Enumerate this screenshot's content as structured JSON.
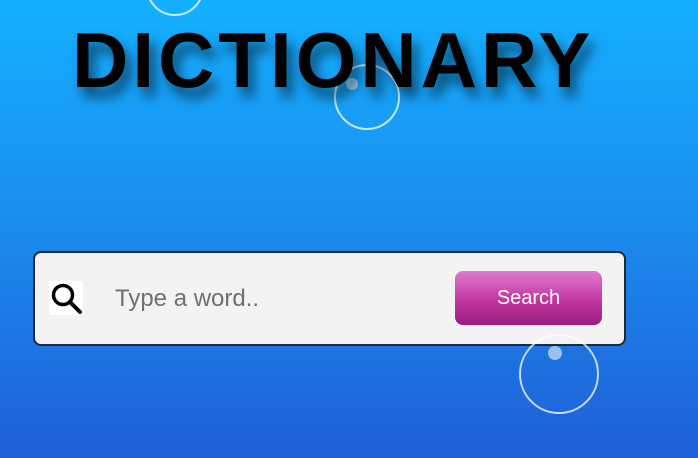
{
  "header": {
    "title": "DICTIONARY"
  },
  "search": {
    "icon": "search-icon",
    "placeholder": "Type a word..",
    "value": "",
    "button_label": "Search"
  },
  "colors": {
    "background_top": "#14b0ff",
    "background_bottom": "#1f5fd6",
    "button_gradient_top": "#e07ad0",
    "button_gradient_bottom": "#9a1c7d",
    "search_box_bg": "#f3f3f3"
  }
}
